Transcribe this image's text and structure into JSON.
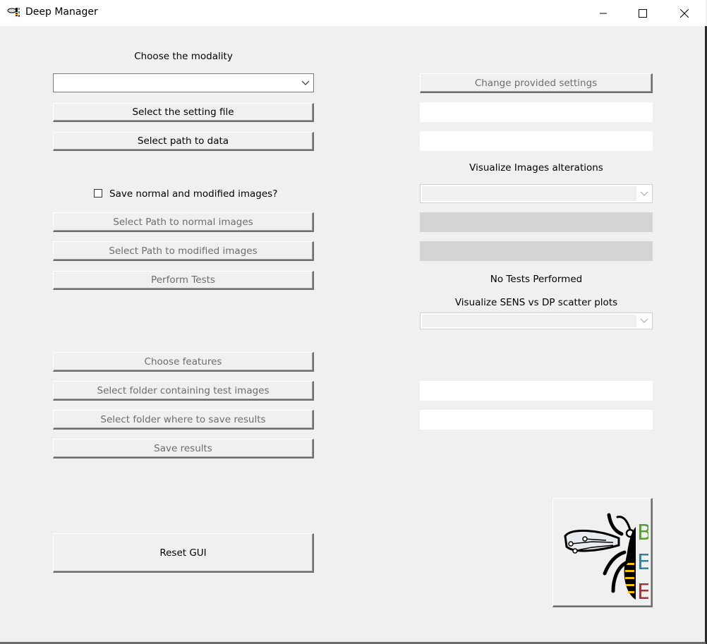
{
  "window": {
    "title": "Deep Manager"
  },
  "left": {
    "modality_label": "Choose the modality",
    "modality_value": "",
    "select_setting_file": "Select the setting file",
    "select_path_data": "Select path to data",
    "save_images_checkbox": "Save normal and modified images?",
    "save_images_checked": false,
    "select_path_normal": "Select Path to normal images",
    "select_path_modified": "Select Path to modified images",
    "perform_tests": "Perform Tests",
    "choose_features": "Choose features",
    "select_test_folder": "Select folder containing test images",
    "select_results_folder": "Select folder where to save results",
    "save_results": "Save results",
    "reset_gui": "Reset GUI"
  },
  "right": {
    "change_settings": "Change provided settings",
    "setting_file_path": "",
    "data_path": "",
    "visualize_alterations_label": "Visualize Images alterations",
    "normal_images_path": "",
    "modified_images_path": "",
    "test_status": "No Tests Performed",
    "visualize_scatter_label": "Visualize SENS vs DP scatter plots",
    "test_folder_path": "",
    "results_folder_path": ""
  },
  "logo": {
    "letters": [
      "B",
      "E",
      "E"
    ],
    "colors": [
      "#5a9a3c",
      "#3c7f8f",
      "#8f3c3c"
    ],
    "stripe_color": "#f5c400"
  }
}
